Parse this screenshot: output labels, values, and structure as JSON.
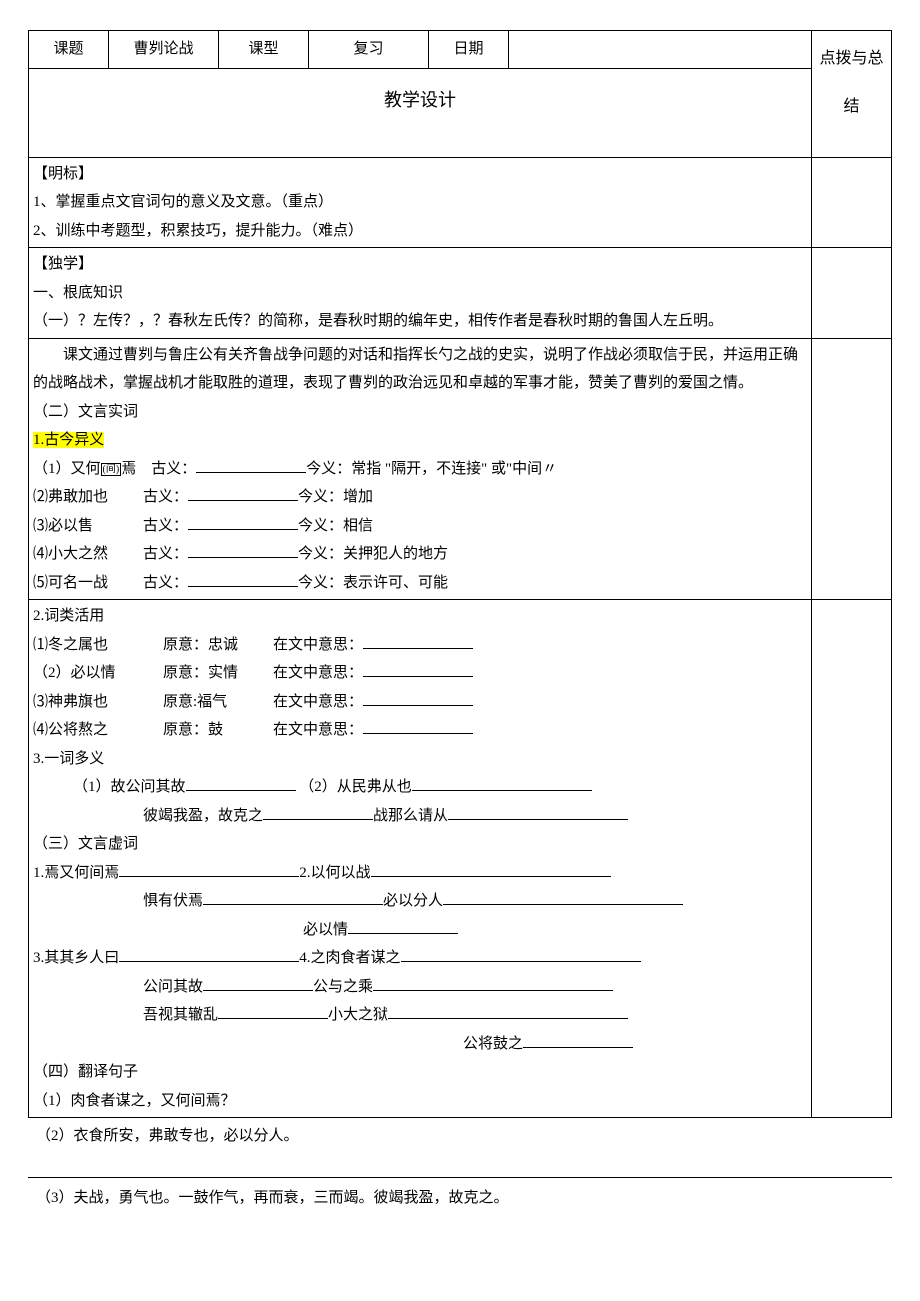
{
  "header": {
    "c1_label": "课题",
    "c1_value": "曹刿论战",
    "c2_label": "课型",
    "c2_value": "复习",
    "c3_label": "日期",
    "c3_value": "",
    "side_col": "点拨与总结",
    "design_title": "教学设计"
  },
  "mingbiao": {
    "title": "【明标】",
    "p1": "1、掌握重点文官词句的意义及文意。（重点）",
    "p2": "2、训练中考题型，积累技巧，提升能力。（难点）"
  },
  "duxue": {
    "title": "【独学】",
    "s1": "一、根底知识",
    "s1_1a": "（一）？左传？，？春秋左氏传？的简称，是春秋时期的编年史，相传作者是春秋时期的鲁国人左丘明。",
    "s1_1b": "课文通过曹刿与鲁庄公有关齐鲁战争问题的对话和指挥长勺之战的史实，说明了作战必须取信于民，并运用正确的战略战术，掌握战机才能取胜的道理，表现了曹刿的政治远见和卓越的军事才能，赞美了曹刿的爱国之情。",
    "s1_2": "（二）文言实词",
    "s1_2_1": "1.古今异义",
    "g1_a": "（1）又何",
    "g1_b": "焉　古义：",
    "g1_c": "今义：常指 \"隔开，不连接\" 或\"中间〃",
    "g2_a": "⑵弗敢加也",
    "g2_b": "古义：",
    "g2_c": "今义：增加",
    "g3_a": "⑶必以售",
    "g3_b": "古义：",
    "g3_c": "今义：相信",
    "g4_a": "⑷小大之然",
    "g4_b": "古义：",
    "g4_c": "今义：关押犯人的地方",
    "g5_a": "⑸可名一战",
    "g5_b": "古义：",
    "g5_c": "今义：表示许可、可能",
    "s1_2_2": "2.词类活用",
    "h1_a": "⑴冬之属也",
    "h1_b": "原意：忠诚",
    "h1_c": "在文中意思：",
    "h2_a": "（2）必以情",
    "h2_b": "原意：实情",
    "h2_c": "在文中意思：",
    "h3_a": "⑶神弗旗也",
    "h3_b": "原意:福气",
    "h3_c": "在文中意思：",
    "h4_a": "⑷公将熬之",
    "h4_b": "原意：鼓",
    "h4_c": "在文中意思：",
    "s1_2_3": "3.一词多义",
    "d1_a": "（1）故公问其故",
    "d1_b": "（2）从民弗从也",
    "d2_a": "彼竭我盈，故克之",
    "d2_b": "战那么请从",
    "s1_3": "（三）文言虚词",
    "x1_a": "1.焉又何间焉",
    "x1_b": "2.以何以战",
    "x2_a": "惧有伏焉",
    "x2_b": "必以分人",
    "x3_a": "必以情",
    "x4_a": "3.其其乡人曰",
    "x4_b": "4.之肉食者谋之",
    "x5_a": "公问其故",
    "x5_b": "公与之乘",
    "x6_a": "吾视其辙乱",
    "x6_b": "小大之狱",
    "x7_a": "公将鼓之",
    "s1_4": "（四）翻译句子",
    "t1": "（1）肉食者谋之，又何间焉？",
    "t2": "（2）衣食所安，弗敢专也，必以分人。",
    "t3": "（3）夫战，勇气也。一鼓作气，再而衰，三而竭。彼竭我盈，故克之。"
  },
  "jian_icon": "(间)"
}
